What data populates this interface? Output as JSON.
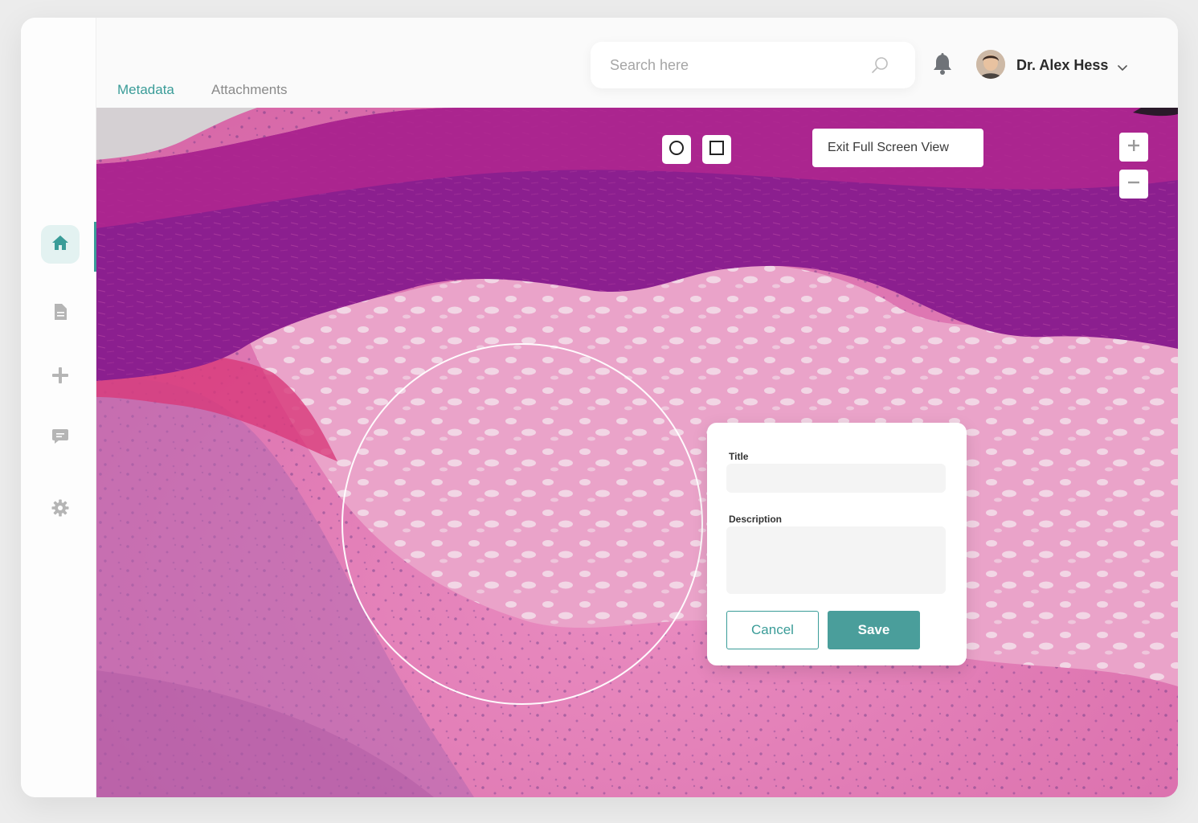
{
  "header": {
    "tabs": [
      {
        "label": "Metadata",
        "active": true
      },
      {
        "label": "Attachments",
        "active": false
      }
    ],
    "search": {
      "placeholder": "Search here",
      "value": ""
    },
    "user": {
      "name": "Dr. Alex Hess"
    }
  },
  "sidebar": {
    "items": [
      {
        "icon": "home-icon",
        "active": true
      },
      {
        "icon": "document-icon",
        "active": false
      },
      {
        "icon": "plus-icon",
        "active": false
      },
      {
        "icon": "chat-icon",
        "active": false
      },
      {
        "icon": "gear-icon",
        "active": false
      }
    ]
  },
  "viewer": {
    "tools": [
      "circle-tool",
      "square-tool"
    ],
    "exit_label": "Exit Full Screen View",
    "zoom_in": "+",
    "zoom_out": "−"
  },
  "annotation_dialog": {
    "title_label": "Title",
    "title_value": "",
    "description_label": "Description",
    "description_value": "",
    "cancel_label": "Cancel",
    "save_label": "Save"
  },
  "colors": {
    "accent": "#3a9c98",
    "accent_light": "#e3f2f1",
    "tissue_purple": "#8b1f8f",
    "tissue_pink": "#e07cb4"
  }
}
